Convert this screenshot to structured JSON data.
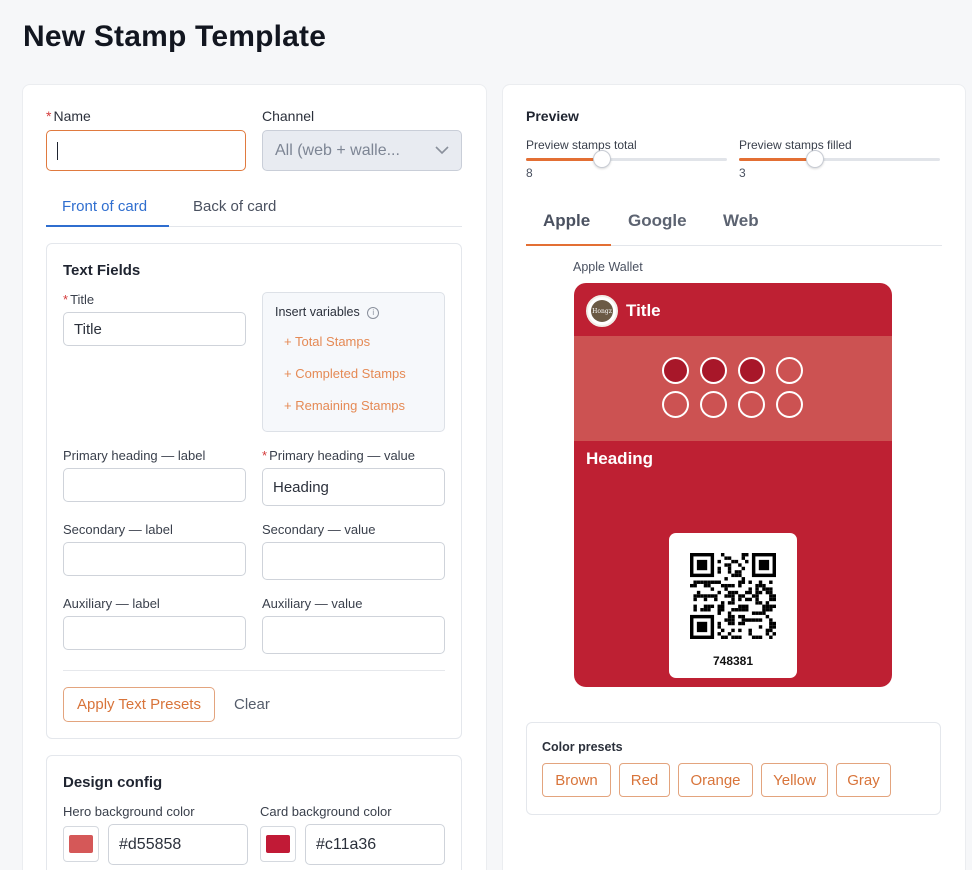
{
  "page": {
    "title": "New Stamp Template"
  },
  "form": {
    "name": {
      "label": "Name",
      "value": ""
    },
    "channel": {
      "label": "Channel",
      "value": "All (web + walle..."
    },
    "tabs": [
      {
        "label": "Front of card",
        "active": true
      },
      {
        "label": "Back of card",
        "active": false
      }
    ]
  },
  "text_fields": {
    "title": "Text Fields",
    "title_field": {
      "label": "Title",
      "value": "Title"
    },
    "insert_variables": {
      "label": "Insert variables",
      "items": [
        "+ Total Stamps",
        "+ Completed Stamps",
        "+ Remaining Stamps"
      ]
    },
    "primary_label": {
      "label": "Primary heading — label",
      "value": ""
    },
    "primary_value": {
      "label": "Primary heading — value",
      "value": "Heading"
    },
    "secondary_label": {
      "label": "Secondary — label",
      "value": ""
    },
    "secondary_value": {
      "label": "Secondary — value",
      "value": ""
    },
    "auxiliary_label": {
      "label": "Auxiliary — label",
      "value": ""
    },
    "auxiliary_value": {
      "label": "Auxiliary — value",
      "value": ""
    },
    "apply_presets": "Apply Text Presets",
    "clear": "Clear"
  },
  "design": {
    "title": "Design config",
    "hero_bg": {
      "label": "Hero background color",
      "value": "#d55858",
      "color": "#d55858"
    },
    "card_bg": {
      "label": "Card background color",
      "value": "#c11a36",
      "color": "#c11a36"
    }
  },
  "preview": {
    "title": "Preview",
    "stamps_total": {
      "label": "Preview stamps total",
      "value": "8",
      "fraction": 0.38
    },
    "stamps_filled": {
      "label": "Preview stamps filled",
      "value": "3",
      "fraction": 0.38
    },
    "tabs": [
      {
        "label": "Apple",
        "active": true
      },
      {
        "label": "Google",
        "active": false
      },
      {
        "label": "Web",
        "active": false
      }
    ],
    "wallet_label": "Apple Wallet",
    "card": {
      "title": "Title",
      "heading": "Heading",
      "code": "748381",
      "logo_text": "Hongz",
      "stamps_total": 8,
      "stamps_filled": 3,
      "card_color": "#be2033",
      "hero_color": "#cc5252"
    },
    "color_presets": {
      "label": "Color presets",
      "items": [
        "Brown",
        "Red",
        "Orange",
        "Yellow",
        "Gray"
      ]
    }
  },
  "colors": {
    "accent": "#e36f34",
    "link_blue": "#2f6ecf"
  }
}
